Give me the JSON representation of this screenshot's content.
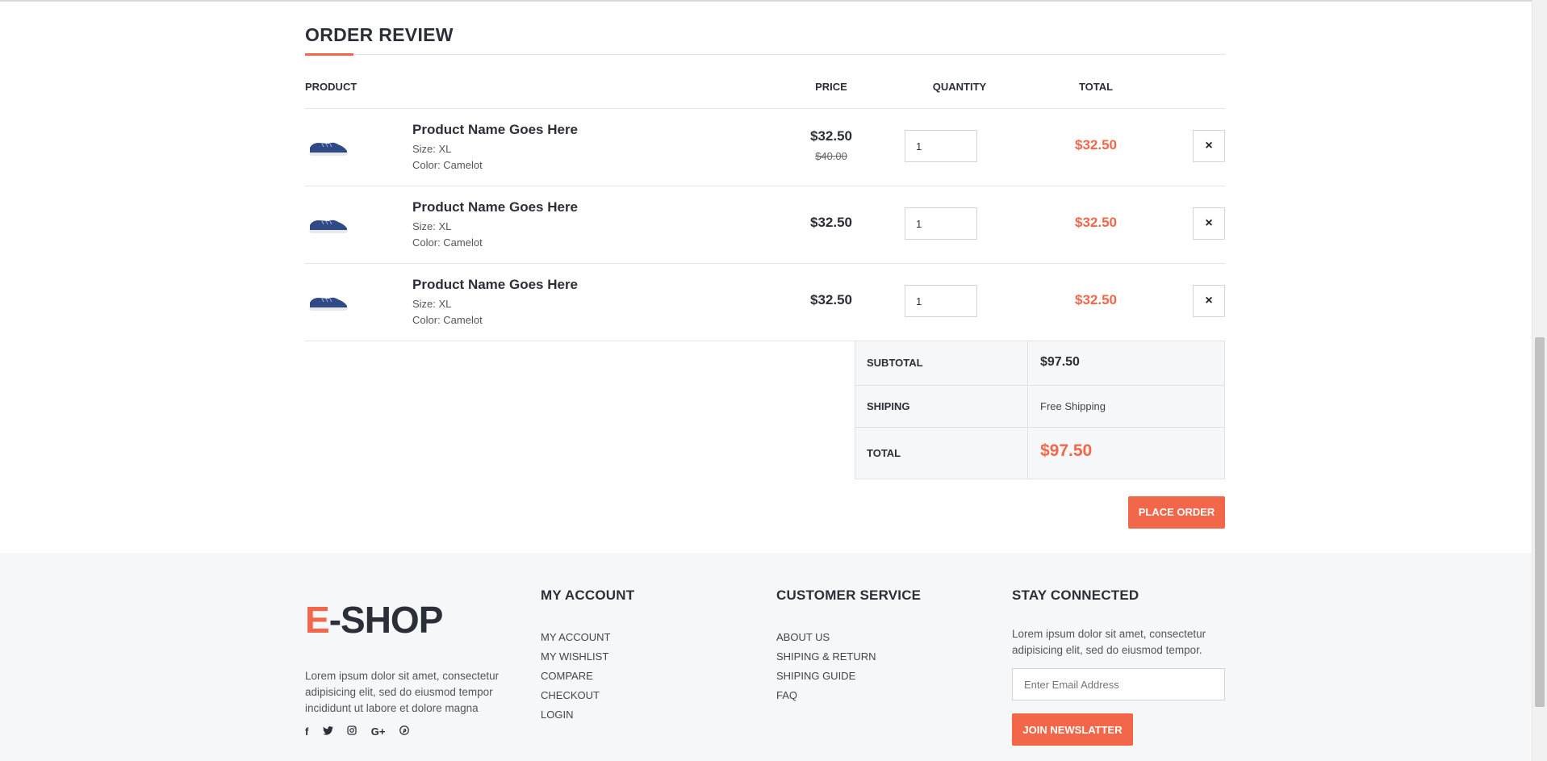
{
  "order_review": {
    "title": "ORDER REVIEW",
    "columns": {
      "product": "PRODUCT",
      "price": "PRICE",
      "quantity": "QUANTITY",
      "total": "TOTAL"
    },
    "items": [
      {
        "name": "Product Name Goes Here",
        "size": "Size: XL",
        "color": "Color: Camelot",
        "price": "$32.50",
        "old_price": "$40.00",
        "quantity": "1",
        "total": "$32.50",
        "remove_icon": "×"
      },
      {
        "name": "Product Name Goes Here",
        "size": "Size: XL",
        "color": "Color: Camelot",
        "price": "$32.50",
        "quantity": "1",
        "total": "$32.50",
        "remove_icon": "×"
      },
      {
        "name": "Product Name Goes Here",
        "size": "Size: XL",
        "color": "Color: Camelot",
        "price": "$32.50",
        "quantity": "1",
        "total": "$32.50",
        "remove_icon": "×"
      }
    ],
    "summary": {
      "subtotal_label": "SUBTOTAL",
      "subtotal_value": "$97.50",
      "shipping_label": "SHIPING",
      "shipping_value": "Free Shipping",
      "total_label": "TOTAL",
      "total_value": "$97.50"
    },
    "place_order_label": "PLACE ORDER"
  },
  "footer": {
    "logo_accent": "E",
    "logo_rest": "-SHOP",
    "about": "Lorem ipsum dolor sit amet, consectetur adipisicing elit, sed do eiusmod tempor incididunt ut labore et dolore magna",
    "social": [
      {
        "icon": "facebook-icon",
        "glyph": "f"
      },
      {
        "icon": "twitter-icon",
        "glyph": "🐦"
      },
      {
        "icon": "instagram-icon",
        "glyph": "◎"
      },
      {
        "icon": "google-plus-icon",
        "glyph": "G+"
      },
      {
        "icon": "pinterest-icon",
        "glyph": "℗"
      }
    ],
    "my_account": {
      "title": "MY ACCOUNT",
      "links": [
        "MY ACCOUNT",
        "MY WISHLIST",
        "COMPARE",
        "CHECKOUT",
        "LOGIN"
      ]
    },
    "customer_service": {
      "title": "CUSTOMER SERVICE",
      "links": [
        "ABOUT US",
        "SHIPING & RETURN",
        "SHIPING GUIDE",
        "FAQ"
      ]
    },
    "stay_connected": {
      "title": "STAY CONNECTED",
      "text": "Lorem ipsum dolor sit amet, consectetur adipisicing elit, sed do eiusmod tempor.",
      "email_placeholder": "Enter Email Address",
      "join_label": "JOIN NEWSLATTER"
    }
  },
  "colors": {
    "accent": "#f26649",
    "text": "#2b2f38",
    "footer_bg": "#f6f7f9"
  }
}
